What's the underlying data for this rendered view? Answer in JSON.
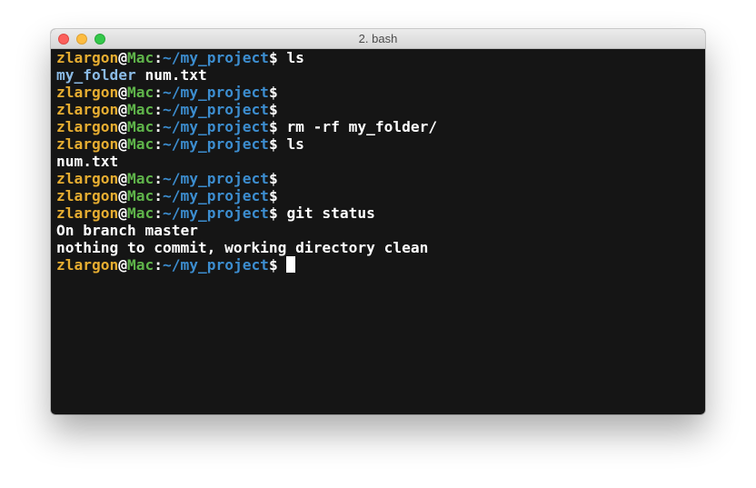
{
  "window": {
    "title": "2. bash",
    "buttons": {
      "close": "close",
      "minimize": "minimize",
      "zoom": "zoom"
    }
  },
  "prompt": {
    "user": "zlargon",
    "at": "@",
    "host": "Mac",
    "colon": ":",
    "path": "~/my_project",
    "symbol": "$"
  },
  "terminal": {
    "lines": [
      {
        "type": "prompt",
        "command": "ls"
      },
      {
        "type": "output_folder",
        "folder": "my_folder",
        "rest": " num.txt"
      },
      {
        "type": "prompt",
        "command": ""
      },
      {
        "type": "prompt",
        "command": ""
      },
      {
        "type": "prompt",
        "command": "rm -rf my_folder/"
      },
      {
        "type": "prompt",
        "command": "ls"
      },
      {
        "type": "output",
        "text": "num.txt"
      },
      {
        "type": "prompt",
        "command": ""
      },
      {
        "type": "prompt",
        "command": ""
      },
      {
        "type": "prompt",
        "command": "git status"
      },
      {
        "type": "output",
        "text": "On branch master"
      },
      {
        "type": "output",
        "text": "nothing to commit, working directory clean"
      },
      {
        "type": "prompt_cursor",
        "command": ""
      }
    ]
  },
  "colors": {
    "background": "#151515",
    "user": "#e6ad31",
    "host": "#5fb44a",
    "path": "#3c8dcf",
    "folder": "#8bbbe6",
    "text": "#ffffff"
  }
}
